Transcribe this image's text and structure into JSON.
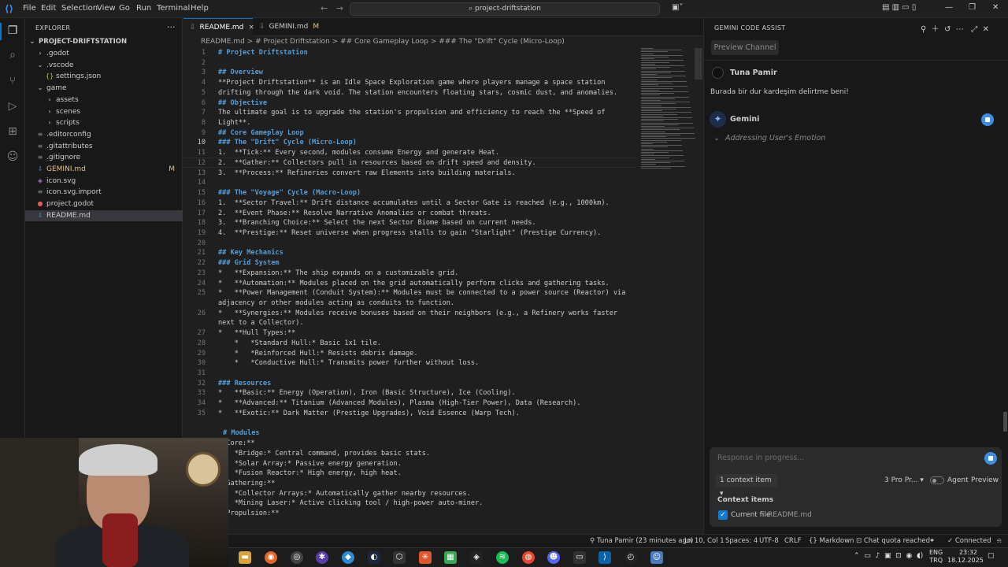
{
  "titlebar": {
    "menus": [
      "File",
      "Edit",
      "Selection",
      "View",
      "Go",
      "Run",
      "Terminal",
      "Help"
    ],
    "search": "project-driftstation"
  },
  "explorer": {
    "title": "EXPLORER",
    "root": "PROJECT-DRIFTSTATION",
    "items": [
      {
        "label": ".godot",
        "kind": "folder"
      },
      {
        "label": ".vscode",
        "kind": "folder-open"
      },
      {
        "label": "settings.json",
        "kind": "json"
      },
      {
        "label": "game",
        "kind": "folder-open"
      },
      {
        "label": "assets",
        "kind": "folder"
      },
      {
        "label": "scenes",
        "kind": "folder"
      },
      {
        "label": "scripts",
        "kind": "folder"
      },
      {
        "label": ".editorconfig",
        "kind": "file"
      },
      {
        "label": ".gitattributes",
        "kind": "file"
      },
      {
        "label": ".gitignore",
        "kind": "file"
      },
      {
        "label": "GEMINI.md",
        "kind": "md",
        "badge": "M"
      },
      {
        "label": "icon.svg",
        "kind": "svg"
      },
      {
        "label": "icon.svg.import",
        "kind": "file"
      },
      {
        "label": "project.godot",
        "kind": "godot"
      },
      {
        "label": "README.md",
        "kind": "md"
      }
    ]
  },
  "tabs": [
    {
      "label": "README.md",
      "active": true,
      "close": "×"
    },
    {
      "label": "GEMINI.md",
      "modified": "M"
    }
  ],
  "breadcrumb": "README.md > # Project Driftstation > ## Core Gameplay Loop > ### The \"Drift\" Cycle (Micro-Loop)",
  "code": {
    "current_line": 10,
    "lines": [
      {
        "n": 1,
        "t": "# Project Driftstation",
        "s": "h"
      },
      {
        "n": 2,
        "t": ""
      },
      {
        "n": 3,
        "t": "## Overview",
        "s": "h"
      },
      {
        "n": 4,
        "t": "**Project Driftstation** is an Idle Space Exploration game where players manage a space station"
      },
      {
        "n": 5,
        "t": "drifting through the dark void. The station encounters floating stars, cosmic dust, and anomalies."
      },
      {
        "n": 6,
        "t": "## Objective",
        "s": "h"
      },
      {
        "n": 7,
        "t": "The ultimate goal is to upgrade the station's propulsion and efficiency to reach the **Speed of"
      },
      {
        "n": 8,
        "t": "Light**."
      },
      {
        "n": 9,
        "t": "## Core Gameplay Loop",
        "s": "h"
      },
      {
        "n": 10,
        "t": "### The \"Drift\" Cycle (Micro-Loop)",
        "s": "h"
      },
      {
        "n": 11,
        "t": "1.  **Tick:** Every second, modules consume Energy and generate Heat."
      },
      {
        "n": 12,
        "t": "2.  **Gather:** Collectors pull in resources based on drift speed and density."
      },
      {
        "n": 13,
        "t": "3.  **Process:** Refineries convert raw Elements into building materials."
      },
      {
        "n": 14,
        "t": ""
      },
      {
        "n": 15,
        "t": "### The \"Voyage\" Cycle (Macro-Loop)",
        "s": "h"
      },
      {
        "n": 16,
        "t": "1.  **Sector Travel:** Drift distance accumulates until a Sector Gate is reached (e.g., 1000km)."
      },
      {
        "n": 17,
        "t": "2.  **Event Phase:** Resolve Narrative Anomalies or combat threats."
      },
      {
        "n": 18,
        "t": "3.  **Branching Choice:** Select the next Sector Biome based on current needs."
      },
      {
        "n": 19,
        "t": "4.  **Prestige:** Reset universe when progress stalls to gain \"Starlight\" (Prestige Currency)."
      },
      {
        "n": 20,
        "t": ""
      },
      {
        "n": 21,
        "t": "## Key Mechanics",
        "s": "h"
      },
      {
        "n": 22,
        "t": "### Grid System",
        "s": "h"
      },
      {
        "n": 23,
        "t": "*   **Expansion:** The ship expands on a customizable grid."
      },
      {
        "n": 24,
        "t": "*   **Automation:** Modules placed on the grid automatically perform clicks and gathering tasks."
      },
      {
        "n": 25,
        "t": "*   **Power Management (Conduit System):** Modules must be connected to a power source (Reactor) via"
      },
      {
        "n": null,
        "t": "adjacency or other modules acting as conduits to function."
      },
      {
        "n": 26,
        "t": "*   **Synergies:** Modules receive bonuses based on their neighbors (e.g., a Refinery works faster"
      },
      {
        "n": null,
        "t": "next to a Collector)."
      },
      {
        "n": 27,
        "t": "*   **Hull Types:**"
      },
      {
        "n": 28,
        "t": "    *   *Standard Hull:* Basic 1x1 tile."
      },
      {
        "n": 29,
        "t": "    *   *Reinforced Hull:* Resists debris damage."
      },
      {
        "n": 30,
        "t": "    *   *Conductive Hull:* Transmits power further without loss."
      },
      {
        "n": 31,
        "t": ""
      },
      {
        "n": 32,
        "t": "### Resources",
        "s": "h"
      },
      {
        "n": 33,
        "t": "*   **Basic:** Energy (Operation), Iron (Basic Structure), Ice (Cooling)."
      },
      {
        "n": 34,
        "t": "*   **Advanced:** Titanium (Advanced Modules), Plasma (High-Tier Power), Data (Research)."
      },
      {
        "n": 35,
        "t": "*   **Exotic:** Dark Matter (Prestige Upgrades), Void Essence (Warp Tech)."
      },
      {
        "n": null,
        "t": ""
      },
      {
        "n": null,
        "t": "# Modules",
        "s": "h"
      },
      {
        "n": null,
        "t": "**Core:**"
      },
      {
        "n": null,
        "t": "*   *Bridge:* Central command, provides basic stats."
      },
      {
        "n": null,
        "t": "*   *Solar Array:* Passive energy generation."
      },
      {
        "n": null,
        "t": "*   *Fusion Reactor:* High energy, high heat."
      },
      {
        "n": null,
        "t": "**Gathering:**"
      },
      {
        "n": null,
        "t": "*   *Collector Arrays:* Automatically gather nearby resources."
      },
      {
        "n": null,
        "t": "*   *Mining Laser:* Active clicking tool / high-power auto-miner."
      },
      {
        "n": null,
        "t": "**Propulsion:**"
      }
    ]
  },
  "gemini": {
    "title": "GEMINI CODE ASSIST",
    "preview_channel": "Preview Channel",
    "user_name": "Tuna Pamir",
    "user_message": "Burada bir dur kardeşim delirtme beni!",
    "assistant_name": "Gemini",
    "thinking": "Addressing User's Emotion",
    "input_placeholder": "Response in progress...",
    "context_button": "1 context item",
    "model": "3 Pro Pr...",
    "agent_label": "Agent",
    "preview_label": "Preview",
    "context_header": "Context items",
    "context_current": "Current file",
    "context_file": "README.md"
  },
  "statusbar": {
    "blame": "Tuna Pamir (23 minutes ago)",
    "position": "Ln 10, Col 1",
    "spaces": "Spaces: 4",
    "encoding": "UTF-8",
    "eol": "CRLF",
    "language": "Markdown",
    "quota": "Chat quota reached",
    "connection": "Connected"
  },
  "taskbar": {
    "lang": "ENG",
    "kbd": "TRQ",
    "time": "23:32",
    "date": "18.12.2025"
  },
  "colors": {
    "accent": "#0078d4",
    "heading": "#569cd6",
    "modified": "#e2c08d"
  }
}
